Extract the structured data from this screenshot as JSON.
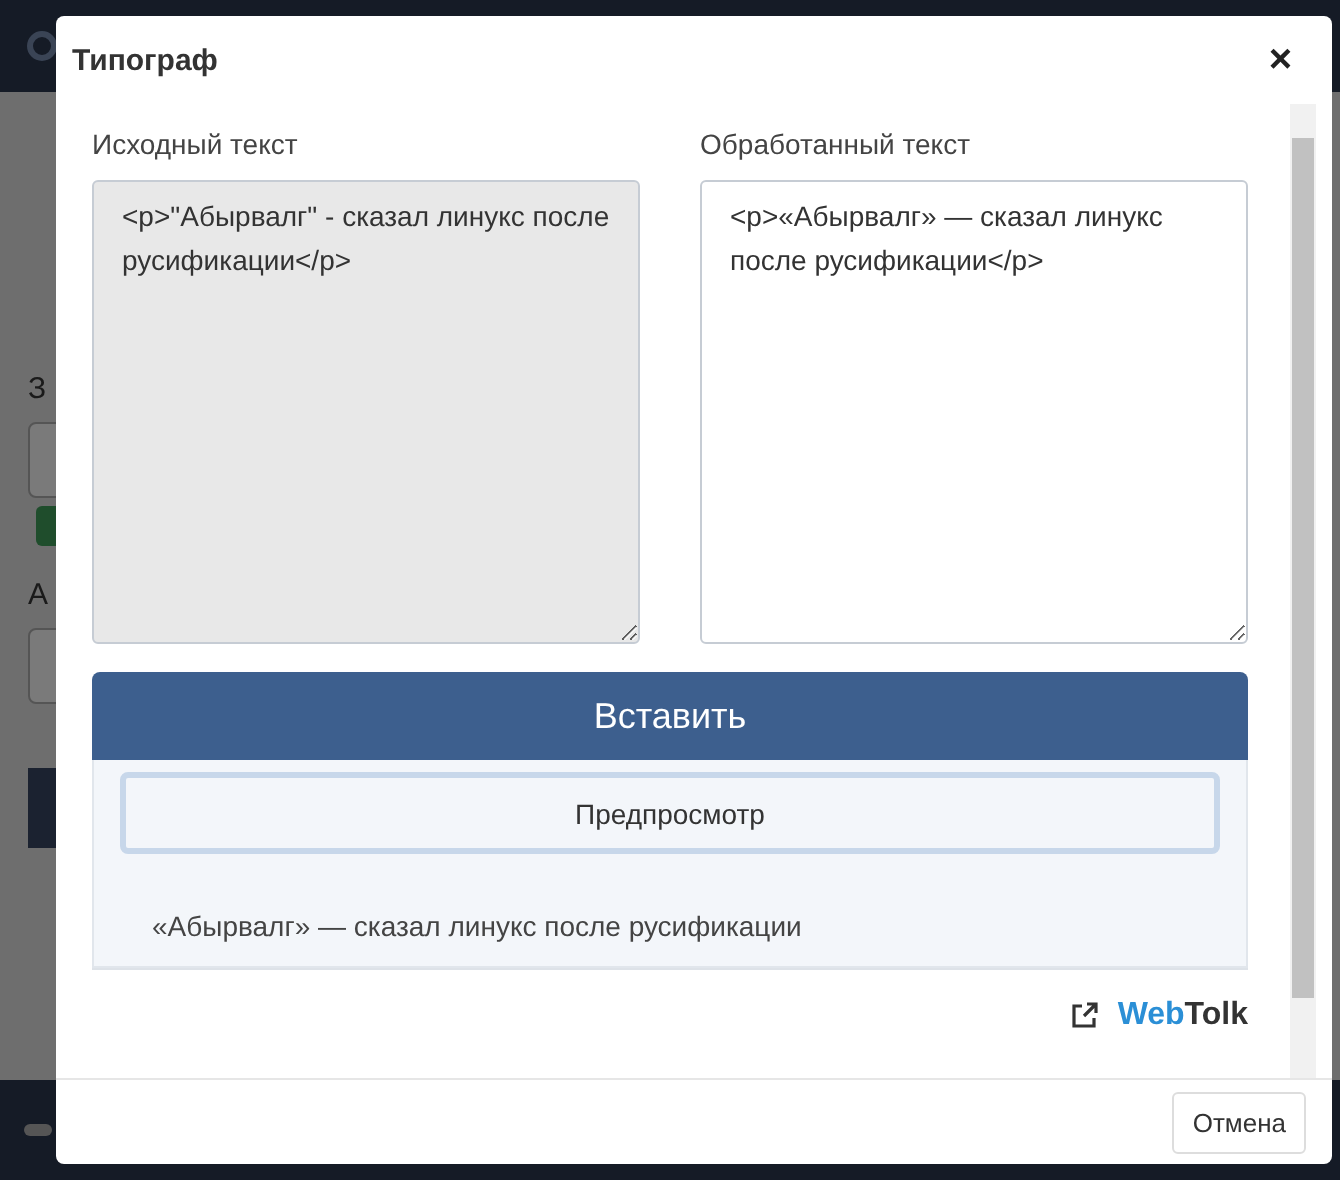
{
  "background": {
    "labels": [
      "З",
      "А"
    ]
  },
  "dialog": {
    "title": "Типограф",
    "close": "×",
    "fields": [
      {
        "label": "Исходный текст",
        "value": "<p>\"Абырвалг\" - сказал линукс после русификации</p>",
        "readonly": true
      },
      {
        "label": "Обработанный текст",
        "value": "<p>«Абырвалг» — сказал линукс после русификации</p>",
        "readonly": false
      }
    ],
    "insert_button": "Вставить",
    "preview_button": "Предпросмотр",
    "preview_text": "«Абырвалг» — сказал линукс после русификации",
    "brand": {
      "part_1": "Web",
      "part_2": "Tolk"
    },
    "cancel_button": "Отмена"
  }
}
